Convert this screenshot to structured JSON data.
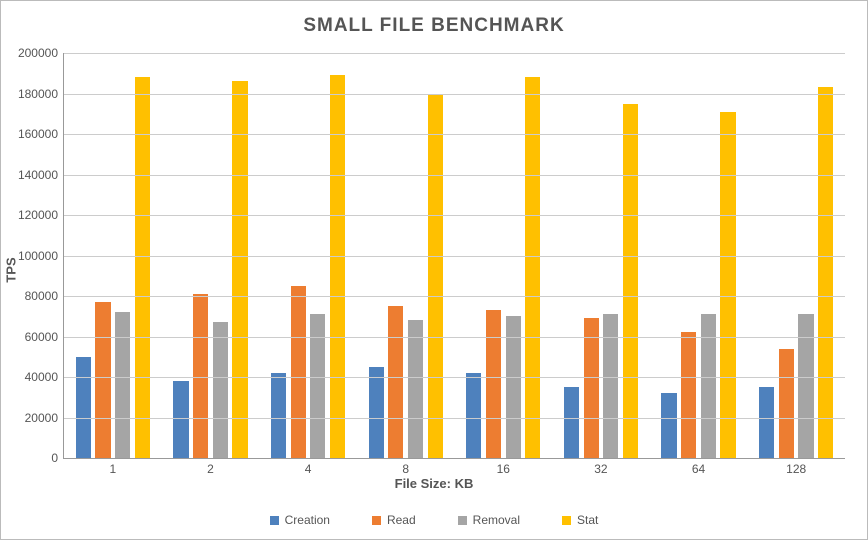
{
  "chart_data": {
    "type": "bar",
    "title": "SMALL FILE BENCHMARK",
    "xlabel": "File Size: KB",
    "ylabel": "TPS",
    "ylim": [
      0,
      200000
    ],
    "ytick_step": 20000,
    "categories": [
      "1",
      "2",
      "4",
      "8",
      "16",
      "32",
      "64",
      "128"
    ],
    "series": [
      {
        "name": "Creation",
        "color": "#4e81bd",
        "values": [
          50000,
          38000,
          42000,
          45000,
          42000,
          35000,
          32000,
          35000
        ]
      },
      {
        "name": "Read",
        "color": "#ed7d31",
        "values": [
          77000,
          81000,
          85000,
          75000,
          73000,
          69000,
          62000,
          54000
        ]
      },
      {
        "name": "Removal",
        "color": "#a5a5a5",
        "values": [
          72000,
          67000,
          71000,
          68000,
          70000,
          71000,
          71000,
          71000
        ]
      },
      {
        "name": "Stat",
        "color": "#ffc000",
        "values": [
          188000,
          186000,
          189000,
          180000,
          188000,
          175000,
          171000,
          183000
        ]
      }
    ]
  }
}
